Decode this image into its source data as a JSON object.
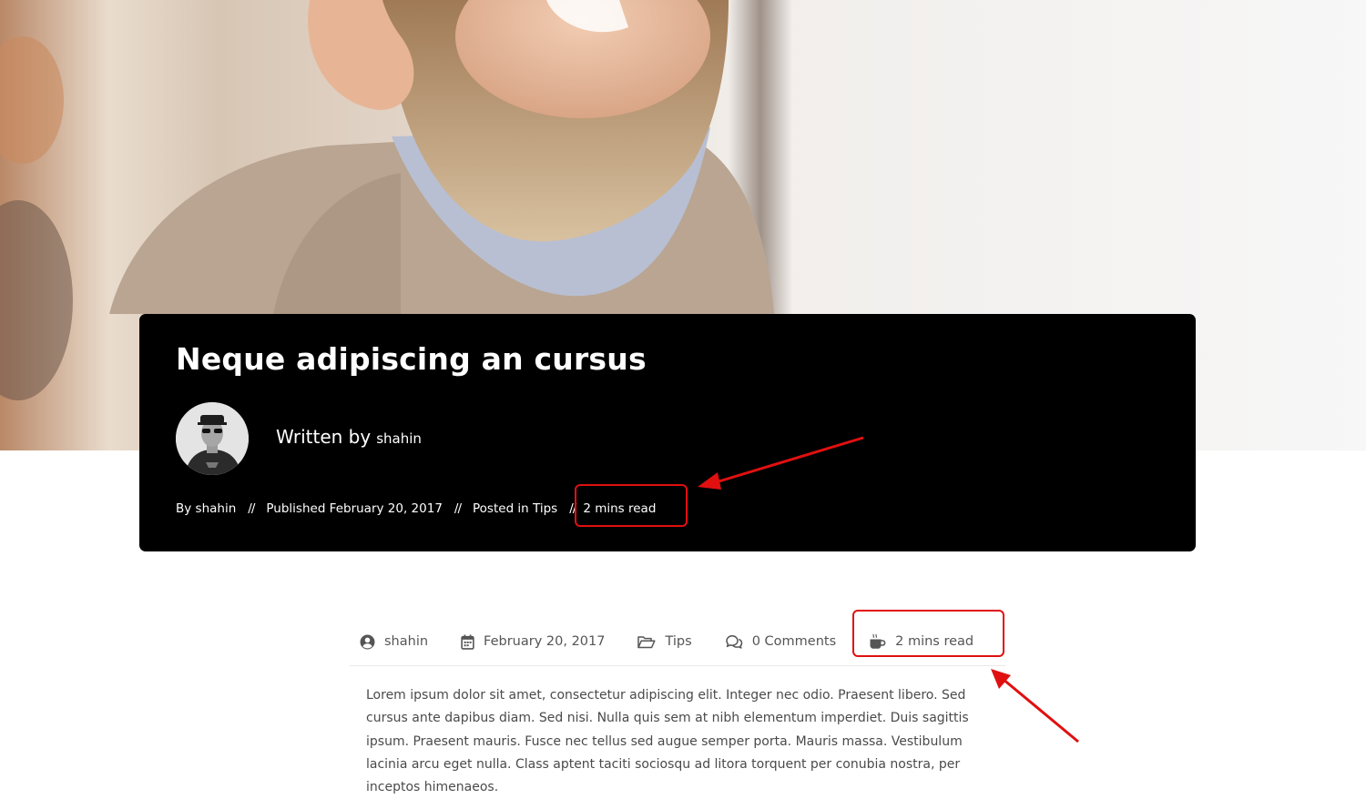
{
  "colors": {
    "card_background": "#000000",
    "annotation_red": "#e01010",
    "meta_text": "#555555"
  },
  "hero": {
    "image_alt": "smiling woman with long hair"
  },
  "title_card": {
    "title": "Neque adipiscing an cursus",
    "written_by_label": "Written by",
    "author_name": "shahin",
    "meta": {
      "by": "By shahin",
      "separator": "//",
      "published": "Published February 20, 2017",
      "posted_in_prefix": "Posted in ",
      "category": "Tips",
      "read_time": "2 mins read"
    }
  },
  "post_meta": {
    "author": "shahin",
    "author_icon": "user-circle-icon",
    "date": "February 20, 2017",
    "date_icon": "calendar-icon",
    "category": "Tips",
    "category_icon": "folder-open-icon",
    "comments": "0 Comments",
    "comments_icon": "comments-icon",
    "read_time": "2 mins read",
    "read_time_icon": "coffee-icon"
  },
  "body": {
    "paragraph": "Lorem ipsum dolor sit amet, consectetur adipiscing elit. Integer nec odio. Praesent libero. Sed cursus ante dapibus diam. Sed nisi. Nulla quis sem at nibh elementum imperdiet. Duis sagittis ipsum. Praesent mauris. Fusce nec tellus sed augue semper porta. Mauris massa. Vestibulum lacinia arcu eget nulla. Class aptent taciti sociosqu ad litora torquent per conubia nostra, per inceptos himenaeos."
  }
}
